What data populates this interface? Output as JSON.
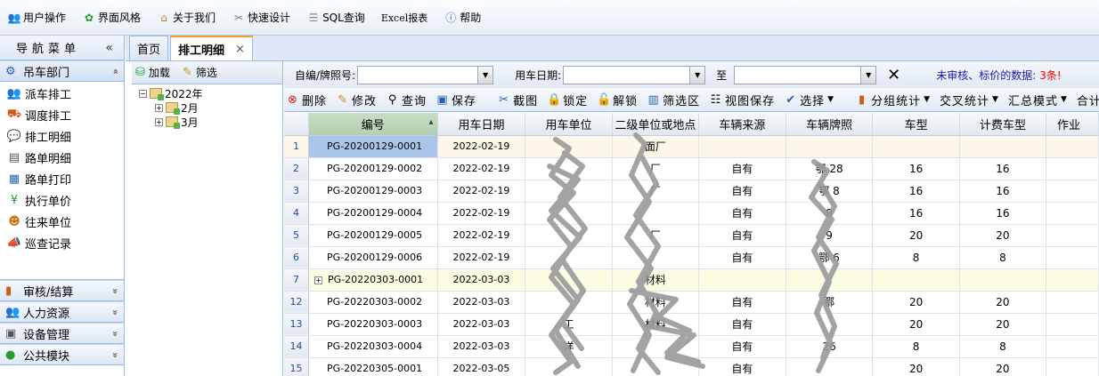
{
  "topbar": {
    "items": [
      {
        "label": "用户操作",
        "icon": "users-icon"
      },
      {
        "label": "界面风格",
        "icon": "palette-icon"
      },
      {
        "label": "关于我们",
        "icon": "home-icon"
      },
      {
        "label": "快速设计",
        "icon": "tools-icon"
      },
      {
        "label": "SQL查询",
        "icon": "database-icon"
      },
      {
        "label": "Excel报表",
        "icon": "excel-icon"
      },
      {
        "label": "帮助",
        "icon": "help-icon"
      }
    ]
  },
  "nav": {
    "title": "导航菜单",
    "collapse_glyph": "«",
    "active_group": {
      "label": "吊车部门",
      "arrow": "»"
    },
    "items": [
      {
        "label": "派车排工",
        "icon": "users-icon"
      },
      {
        "label": "调度排工",
        "icon": "basket-icon"
      },
      {
        "label": "排工明细",
        "icon": "chat-icon"
      },
      {
        "label": "路单明细",
        "icon": "document-icon"
      },
      {
        "label": "路单打印",
        "icon": "print-icon"
      },
      {
        "label": "执行单价",
        "icon": "yen-icon"
      },
      {
        "label": "往来单位",
        "icon": "contact-icon"
      },
      {
        "label": "巡查记录",
        "icon": "megaphone-icon"
      }
    ],
    "groups": [
      {
        "label": "审核/结算",
        "icon": "chart-icon",
        "arrow": "»"
      },
      {
        "label": "人力资源",
        "icon": "people-icon",
        "arrow": "»"
      },
      {
        "label": "设备管理",
        "icon": "device-icon",
        "arrow": "»"
      },
      {
        "label": "公共模块",
        "icon": "globe-icon",
        "arrow": "»"
      }
    ]
  },
  "tabs": [
    {
      "label": "首页",
      "active": false
    },
    {
      "label": "排工明细",
      "active": true,
      "close": "×"
    }
  ],
  "tree": {
    "toolbar": {
      "load": "加载",
      "filter": "筛选"
    },
    "root": {
      "label": "2022年",
      "expander": "−"
    },
    "children": [
      {
        "label": "2月",
        "expander": "+"
      },
      {
        "label": "3月",
        "expander": "+"
      }
    ]
  },
  "filter": {
    "code_label": "自编/牌照号:",
    "code_value": "",
    "date_label": "用车日期:",
    "date_from": "",
    "to_label": "至",
    "date_to": "",
    "clear_glyph": "✕",
    "warning_text": "未审核、标价的数据:",
    "warning_count": "3条!"
  },
  "actions": {
    "delete": "删除",
    "edit": "修改",
    "query": "查询",
    "save": "保存",
    "screenshot": "截图",
    "lock": "锁定",
    "unlock": "解锁",
    "filter_area": "筛选区",
    "view_save": "视图保存",
    "select": "选择",
    "group_stats": "分组统计",
    "cross_stats": "交叉统计",
    "summary_mode": "汇总模式",
    "total": "合计模式"
  },
  "grid": {
    "columns": [
      "",
      "编号",
      "用车日期",
      "用车单位",
      "二级单位或地点",
      "车辆来源",
      "车辆牌照",
      "车型",
      "计费车型",
      "作业"
    ],
    "rows": [
      {
        "rn": "1",
        "code": "PG-20200129-0001",
        "date": "2022-02-19",
        "unit": "",
        "sub": "面厂",
        "source": "",
        "plate": "",
        "type": "",
        "bill": "",
        "style": "sel"
      },
      {
        "rn": "2",
        "code": "PG-20200129-0002",
        "date": "2022-02-19",
        "unit": "",
        "sub": "厂",
        "source": "自有",
        "plate": "鄂   28",
        "type": "16",
        "bill": "16",
        "style": ""
      },
      {
        "rn": "3",
        "code": "PG-20200129-0003",
        "date": "2022-02-19",
        "unit": "",
        "sub": "厂",
        "source": "自有",
        "plate": "鄂   8",
        "type": "16",
        "bill": "16",
        "style": ""
      },
      {
        "rn": "4",
        "code": "PG-20200129-0004",
        "date": "2022-02-19",
        "unit": "",
        "sub": "",
        "source": "自有",
        "plate": "8",
        "type": "16",
        "bill": "16",
        "style": ""
      },
      {
        "rn": "5",
        "code": "PG-20200129-0005",
        "date": "2022-02-19",
        "unit": "",
        "sub": "厂",
        "source": "自有",
        "plate": "9",
        "type": "20",
        "bill": "20",
        "style": ""
      },
      {
        "rn": "6",
        "code": "PG-20200129-0006",
        "date": "2022-02-19",
        "unit": "",
        "sub": "",
        "source": "自有",
        "plate": "鄂   6",
        "type": "8",
        "bill": "8",
        "style": ""
      },
      {
        "rn": "7",
        "code": "PG-20220303-0001",
        "date": "2022-03-03",
        "unit": "",
        "sub": "材料",
        "source": "",
        "plate": "",
        "type": "",
        "bill": "",
        "style": "grp"
      },
      {
        "rn": "12",
        "code": "PG-20220303-0002",
        "date": "2022-03-03",
        "unit": "",
        "sub": "材料",
        "source": "自有",
        "plate": "鄂",
        "type": "20",
        "bill": "20",
        "style": ""
      },
      {
        "rn": "13",
        "code": "PG-20220303-0003",
        "date": "2022-03-03",
        "unit": "工",
        "sub": "材料",
        "source": "自有",
        "plate": "",
        "type": "20",
        "bill": "20",
        "style": ""
      },
      {
        "rn": "14",
        "code": "PG-20220303-0004",
        "date": "2022-03-03",
        "unit": "洋",
        "sub": "",
        "source": "自有",
        "plate": "26",
        "type": "8",
        "bill": "8",
        "style": ""
      },
      {
        "rn": "15",
        "code": "PG-20220305-0001",
        "date": "2022-03-05",
        "unit": "",
        "sub": "",
        "source": "自有",
        "plate": "",
        "type": "20",
        "bill": "20",
        "style": ""
      }
    ]
  }
}
